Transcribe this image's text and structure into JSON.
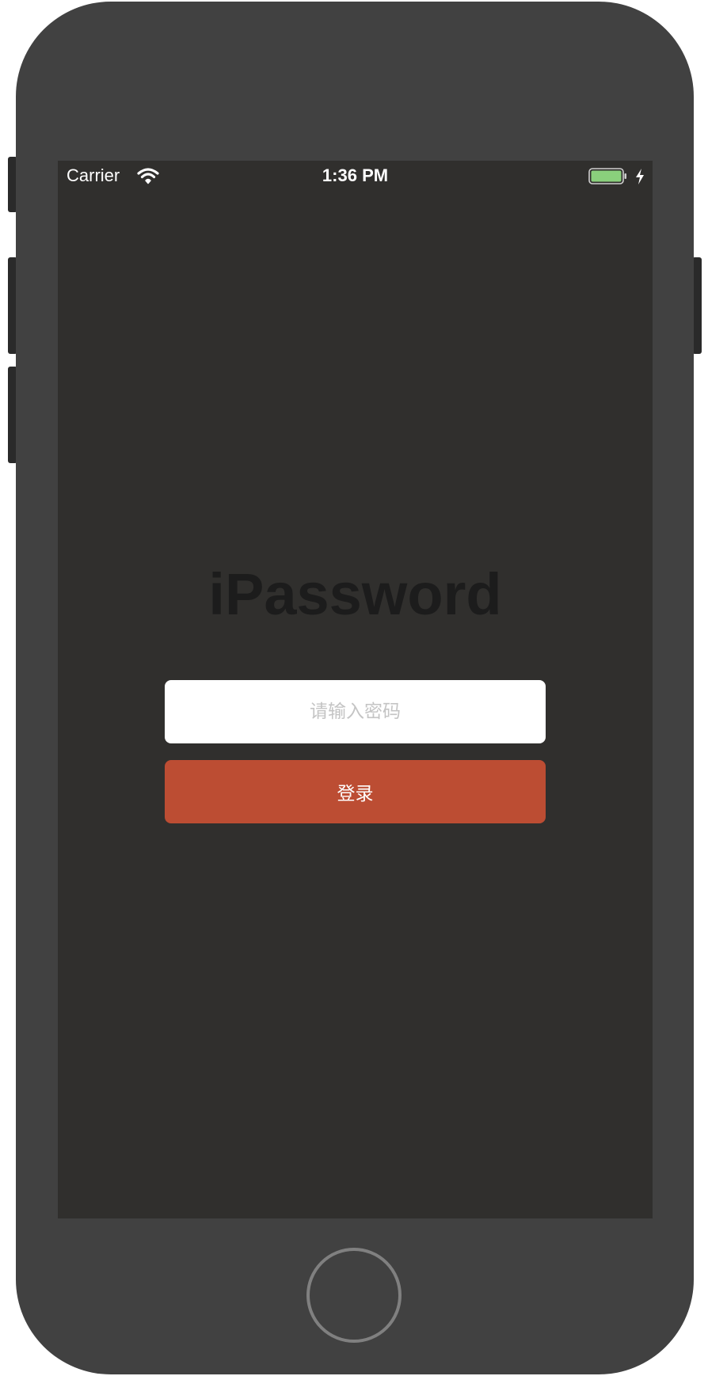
{
  "status_bar": {
    "carrier": "Carrier",
    "time": "1:36 PM",
    "wifi_icon": "wifi-icon",
    "battery_icon": "battery-icon",
    "charging_icon": "charging-bolt-icon",
    "battery_color": "#8ad07c"
  },
  "app": {
    "title": "iPassword",
    "password_placeholder": "请输入密码",
    "password_value": "",
    "login_label": "登录"
  },
  "colors": {
    "screen_background": "#302f2d",
    "device_body": "#414141",
    "login_button": "#bc4d33",
    "title_text": "#1c1c1c"
  }
}
